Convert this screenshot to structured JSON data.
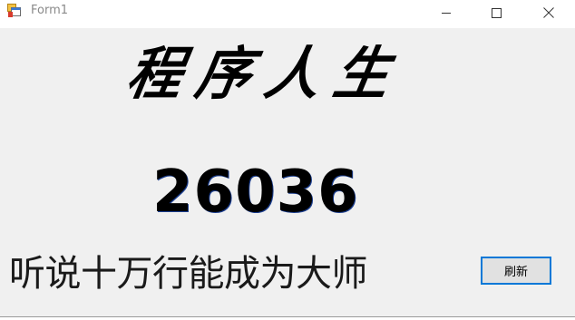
{
  "window": {
    "title": "Form1",
    "icon": "winforms-app-icon",
    "controls": {
      "minimize_icon": "minimize-icon",
      "maximize_icon": "maximize-icon",
      "close_icon": "close-icon"
    }
  },
  "content": {
    "heading": "程序人生",
    "counter_value": "26036",
    "slogan": "听说十万行能成为大师",
    "refresh_label": "刷新"
  },
  "colors": {
    "form_background": "#f0f0f0",
    "titlebar_background": "#ffffff",
    "button_focus_border": "#0078d7",
    "text": "#000000"
  }
}
